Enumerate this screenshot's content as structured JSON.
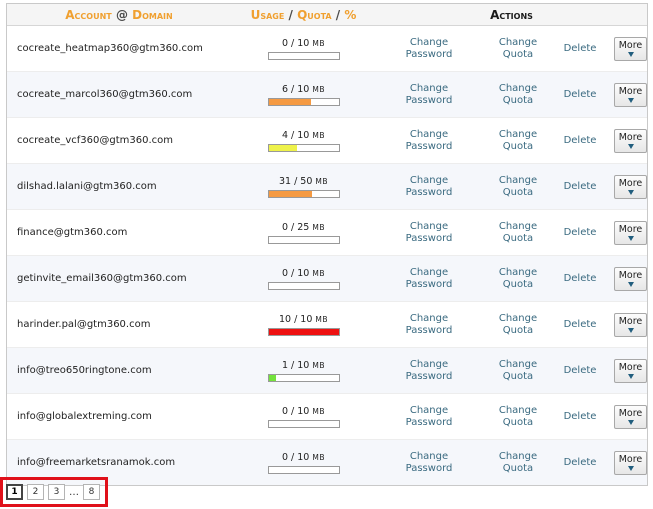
{
  "header": {
    "account": "Account",
    "at": "@",
    "domain": "Domain",
    "usage": "Usage",
    "slash1": "/",
    "quota": "Quota",
    "slash2": "/",
    "percent": "%",
    "actions": "Actions"
  },
  "actions": {
    "change_password_line1": "Change",
    "change_password_line2": "Password",
    "change_quota_line1": "Change",
    "change_quota_line2": "Quota",
    "delete": "Delete",
    "more": "More"
  },
  "bar_colors": {
    "normal": "#f59a42",
    "medium": "#eef24a",
    "full": "#ee1111",
    "low": "#74e23c"
  },
  "accounts": [
    {
      "email": "cocreate_heatmap360@gtm360.com",
      "used": "0",
      "quota": "10",
      "unit": "MB",
      "fraction": 0,
      "level": "normal"
    },
    {
      "email": "cocreate_marcol360@gtm360.com",
      "used": "6",
      "quota": "10",
      "unit": "MB",
      "fraction": 0.6,
      "level": "normal"
    },
    {
      "email": "cocreate_vcf360@gtm360.com",
      "used": "4",
      "quota": "10",
      "unit": "MB",
      "fraction": 0.4,
      "level": "medium"
    },
    {
      "email": "dilshad.lalani@gtm360.com",
      "used": "31",
      "quota": "50",
      "unit": "MB",
      "fraction": 0.62,
      "level": "normal"
    },
    {
      "email": "finance@gtm360.com",
      "used": "0",
      "quota": "25",
      "unit": "MB",
      "fraction": 0,
      "level": "normal"
    },
    {
      "email": "getinvite_email360@gtm360.com",
      "used": "0",
      "quota": "10",
      "unit": "MB",
      "fraction": 0,
      "level": "normal"
    },
    {
      "email": "harinder.pal@gtm360.com",
      "used": "10",
      "quota": "10",
      "unit": "MB",
      "fraction": 1.0,
      "level": "full"
    },
    {
      "email": "info@treo650ringtone.com",
      "used": "1",
      "quota": "10",
      "unit": "MB",
      "fraction": 0.1,
      "level": "low"
    },
    {
      "email": "info@globalextreming.com",
      "used": "0",
      "quota": "10",
      "unit": "MB",
      "fraction": 0,
      "level": "normal"
    },
    {
      "email": "info@freemarketsranamok.com",
      "used": "0",
      "quota": "10",
      "unit": "MB",
      "fraction": 0,
      "level": "normal"
    }
  ],
  "pagination": {
    "pages": [
      "1",
      "2",
      "3"
    ],
    "ellipsis": "…",
    "last": "8",
    "current": "1"
  }
}
